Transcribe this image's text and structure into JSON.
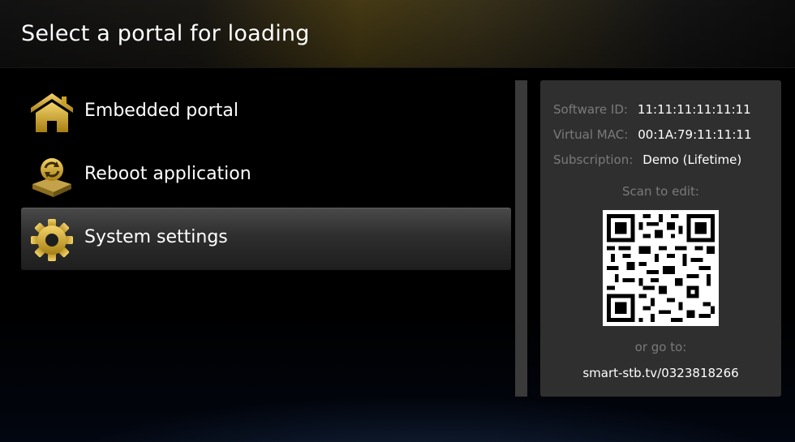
{
  "header": {
    "title": "Select a portal for loading"
  },
  "menu": {
    "items": [
      {
        "label": "Embedded portal",
        "icon": "home-icon",
        "selected": false
      },
      {
        "label": "Reboot application",
        "icon": "reboot-device-icon",
        "selected": false
      },
      {
        "label": "System settings",
        "icon": "gear-icon",
        "selected": true
      }
    ]
  },
  "info": {
    "software_id_label": "Software ID:",
    "software_id": "11:11:11:11:11:11",
    "virtual_mac_label": "Virtual MAC:",
    "virtual_mac": "00:1A:79:11:11:11",
    "subscription_label": "Subscription:",
    "subscription": "Demo (Lifetime)",
    "scan_text": "Scan to edit:",
    "qr_icon": "qr-code",
    "or_go_to": "or go to:",
    "url": "smart-stb.tv/0323818266"
  },
  "colors": {
    "accent_gold": "#c9a227",
    "panel_bg": "#2f2f2f",
    "muted_text": "#7a7a7a"
  }
}
